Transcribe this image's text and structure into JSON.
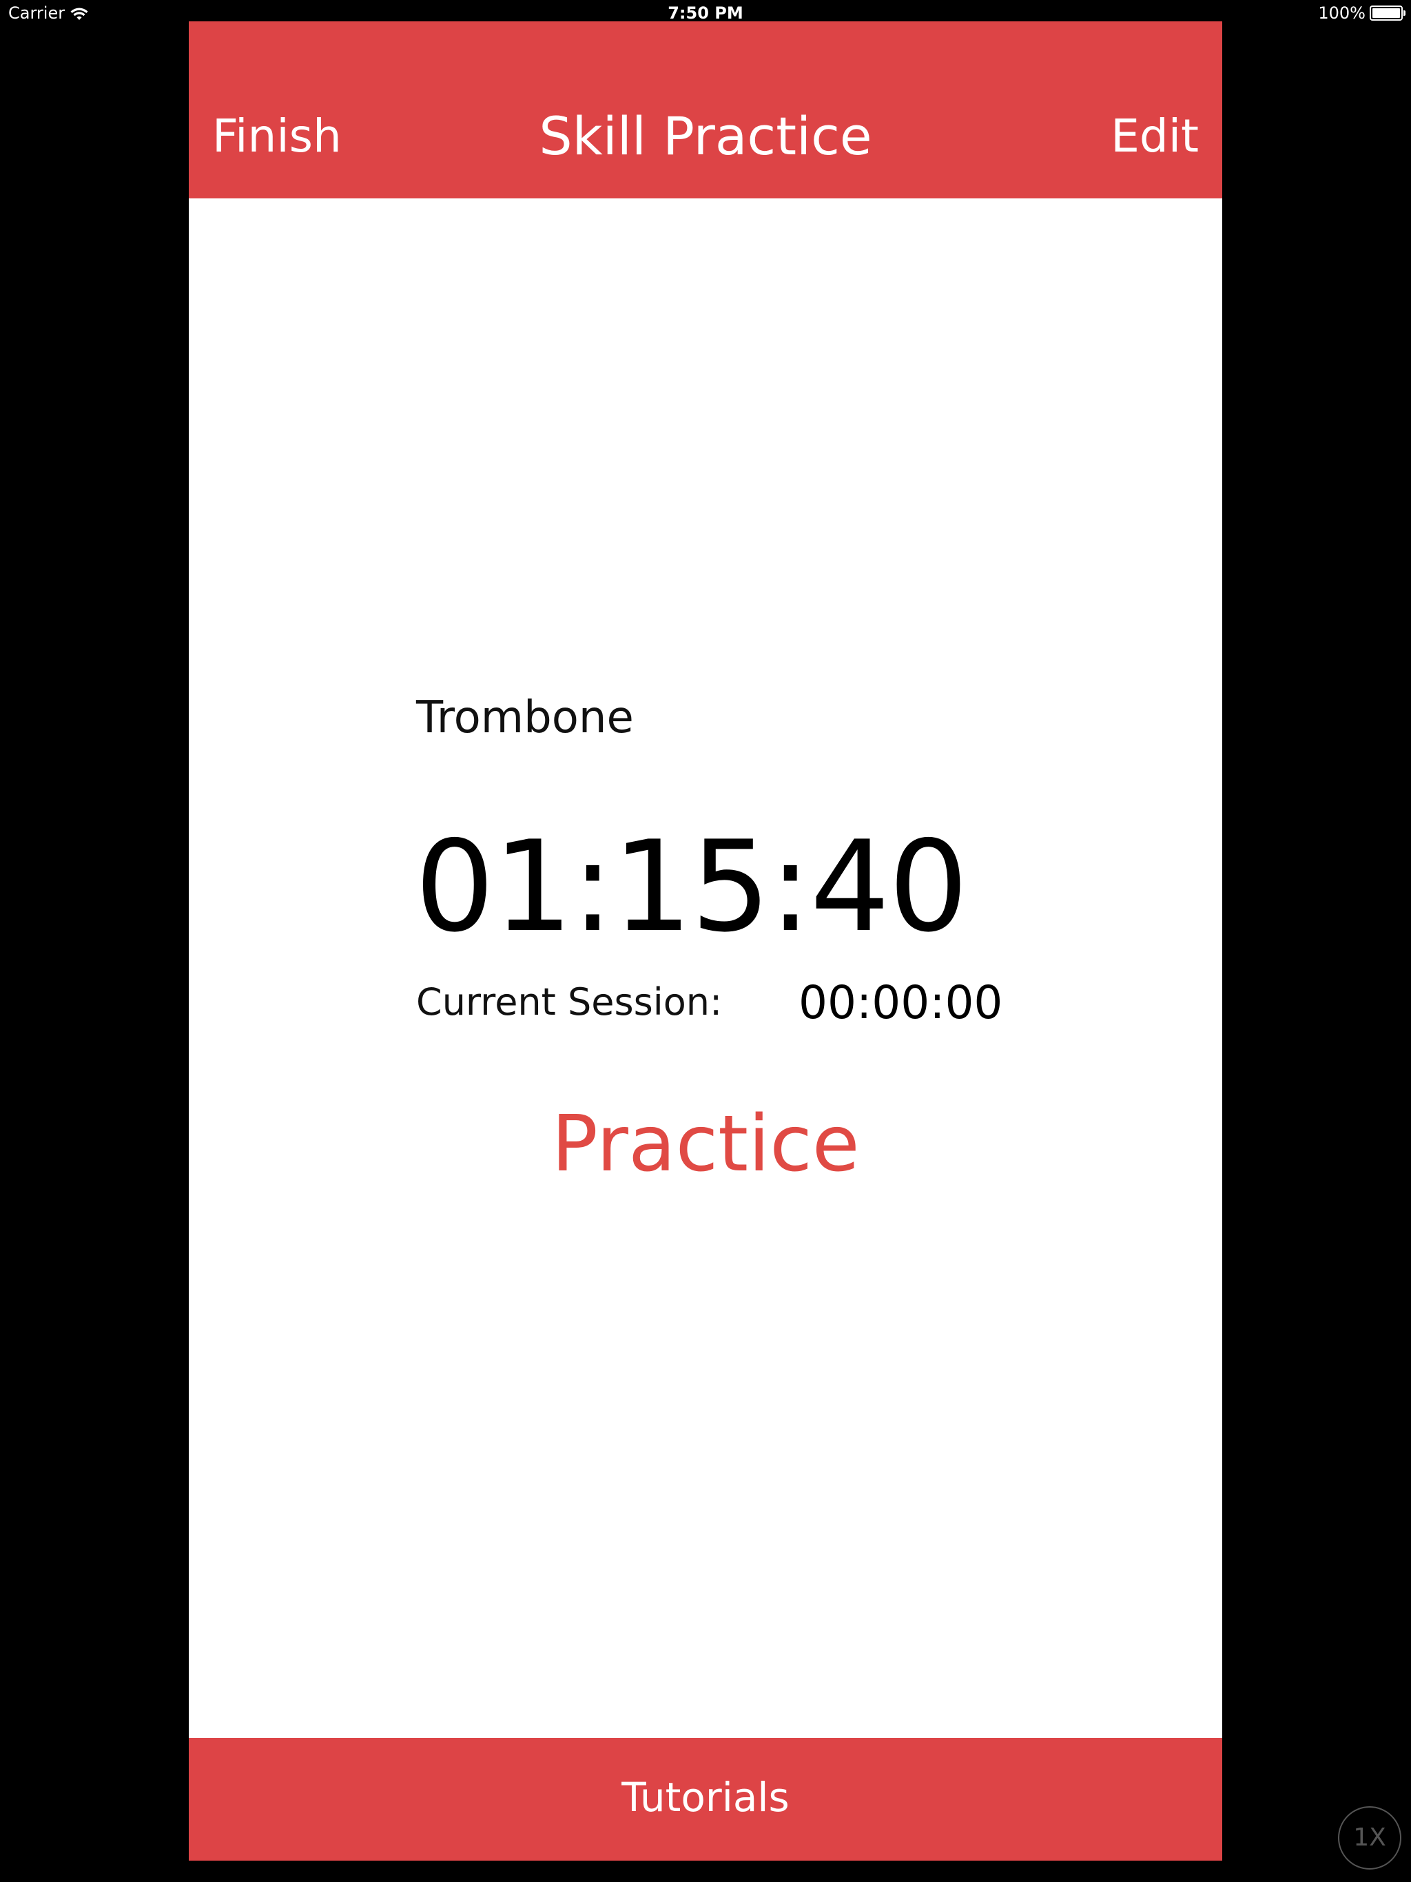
{
  "status_bar": {
    "carrier": "Carrier",
    "time": "7:50 PM",
    "battery": "100%",
    "battery_level": 1.0,
    "icons": [
      "wifi-icon",
      "battery-icon"
    ]
  },
  "nav": {
    "left_label": "Finish",
    "title": "Skill Practice",
    "right_label": "Edit"
  },
  "main": {
    "skill_name": "Trombone",
    "total_time": "01:15:40",
    "session_label": "Current Session:",
    "session_time": "00:00:00",
    "practice_label": "Practice"
  },
  "bottom_bar": {
    "label": "Tutorials"
  },
  "simulator": {
    "zoom_label": "1X"
  },
  "colors": {
    "accent": "#dd4446",
    "practice_text": "#e04a44",
    "background": "#ffffff",
    "outer": "#000000"
  }
}
